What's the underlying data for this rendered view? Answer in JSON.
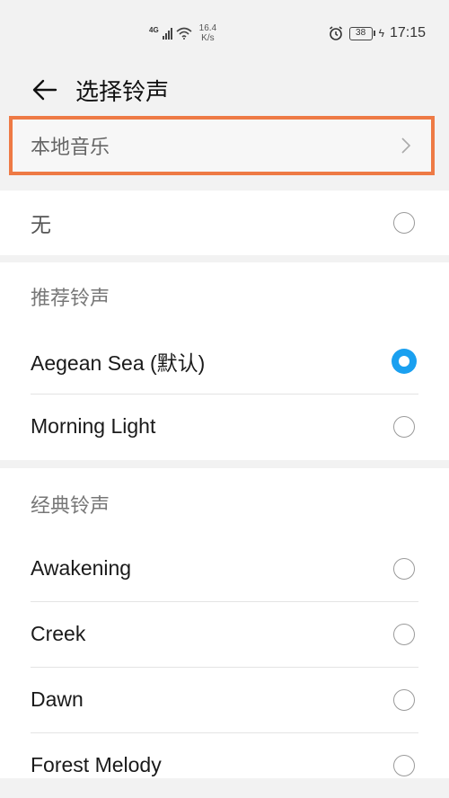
{
  "status_bar": {
    "network": "4G",
    "speed_value": "16.4",
    "speed_unit": "K/s",
    "battery": "38",
    "time": "17:15"
  },
  "header": {
    "title": "选择铃声"
  },
  "local_music": {
    "label": "本地音乐"
  },
  "none_option": {
    "label": "无"
  },
  "recommended": {
    "title": "推荐铃声",
    "items": [
      {
        "label": "Aegean Sea (默认)",
        "selected": true
      },
      {
        "label": "Morning Light",
        "selected": false
      }
    ]
  },
  "classic": {
    "title": "经典铃声",
    "items": [
      {
        "label": "Awakening",
        "selected": false
      },
      {
        "label": "Creek",
        "selected": false
      },
      {
        "label": "Dawn",
        "selected": false
      },
      {
        "label": "Forest Melody",
        "selected": false
      }
    ]
  },
  "colors": {
    "accent": "#1aa0f0",
    "highlight_border": "#ee7a45"
  }
}
